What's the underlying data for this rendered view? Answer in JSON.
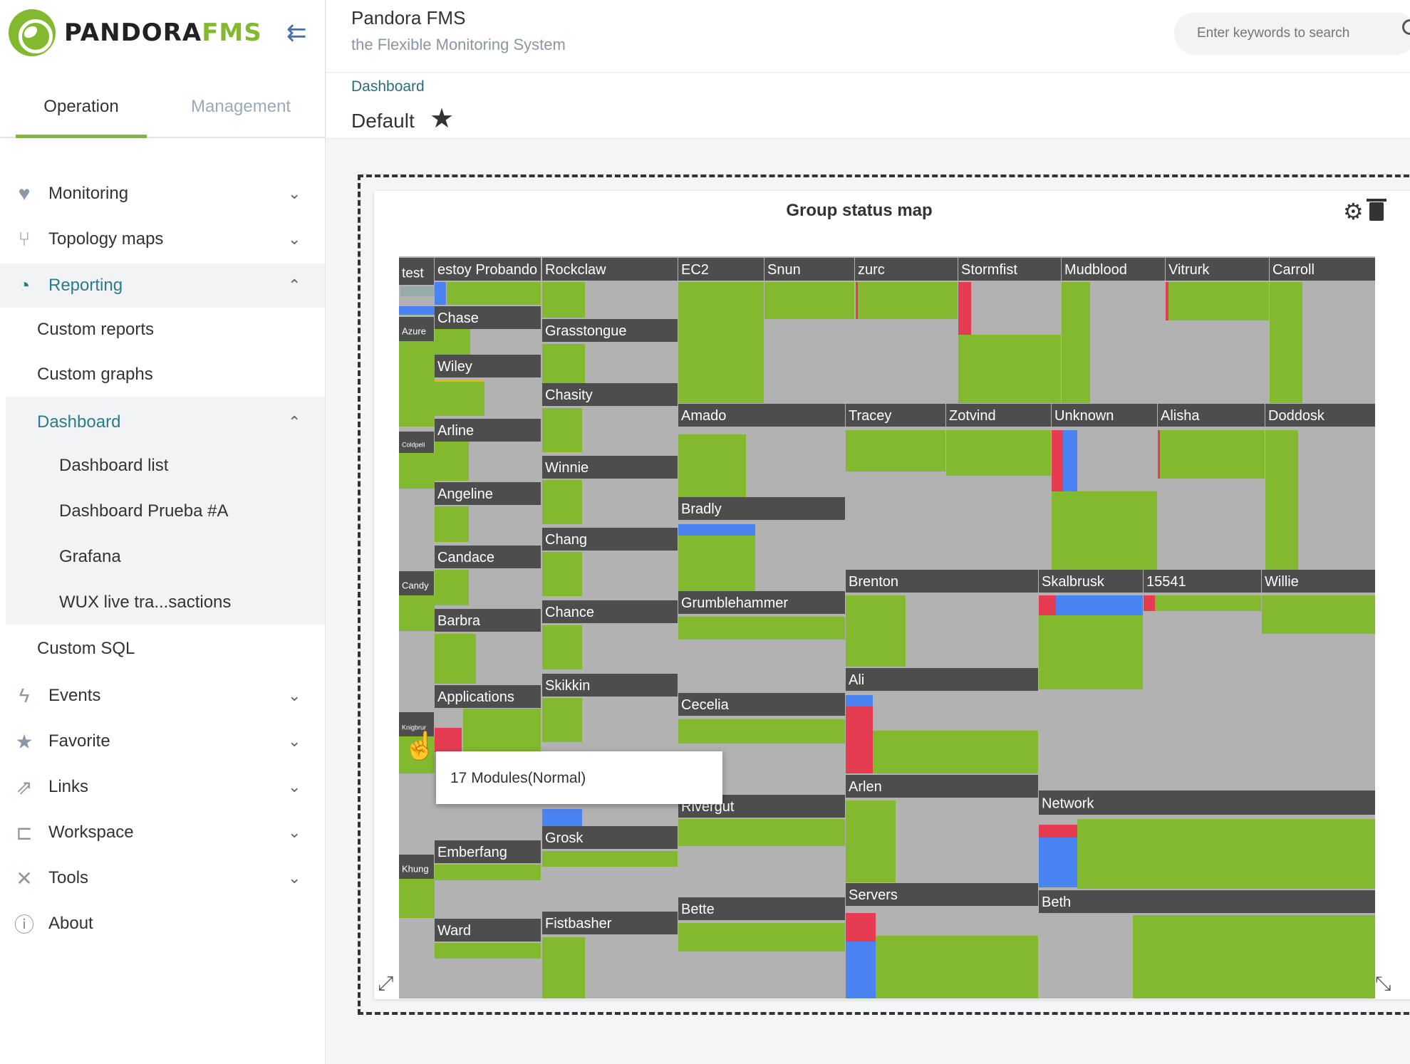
{
  "brand": {
    "name_a": "PANDORA",
    "name_b": "FMS",
    "logo": "pandora-logo",
    "color": "#82b92e"
  },
  "header": {
    "title": "Pandora FMS",
    "subtitle": "the Flexible Monitoring System",
    "search_placeholder": "Enter keywords to search"
  },
  "tabs": {
    "operation": "Operation",
    "management": "Management"
  },
  "menu": {
    "monitoring": "Monitoring",
    "topology": "Topology maps",
    "reporting": "Reporting",
    "custom_reports": "Custom reports",
    "custom_graphs": "Custom graphs",
    "dashboard": "Dashboard",
    "dashboard_list": "Dashboard list",
    "dashboard_prueba": "Dashboard Prueba #A",
    "grafana": "Grafana",
    "wux": "WUX live tra...sactions",
    "custom_sql": "Custom SQL",
    "events": "Events",
    "favorite": "Favorite",
    "links": "Links",
    "workspace": "Workspace",
    "tools": "Tools",
    "about": "About"
  },
  "breadcrumb": "Dashboard",
  "page_title": "Default",
  "widget": {
    "title": "Group status map",
    "tooltip": "17 Modules(Normal)"
  },
  "colors": {
    "normal": "#82b92e",
    "unknown": "#b2b2b2",
    "critical": "#e63c52",
    "notinit": "#4a83f2",
    "warning": "#f3b200",
    "label_bg": "#4d4d4d"
  },
  "groups": [
    "test",
    "estoy Probando",
    "Rockclaw",
    "EC2",
    "Snun",
    "zurc",
    "Stormfist",
    "Mudblood",
    "Vitrurk",
    "Carroll",
    "Azure",
    "Chase",
    "Grasstongue",
    "Wiley",
    "Chasity",
    "Arline",
    "Winnie",
    "Amado",
    "Tracey",
    "Zotvind",
    "Unknown",
    "Alisha",
    "Doddosk",
    "Coldpeli",
    "Angeline",
    "Bradly",
    "Chang",
    "Candace",
    "Candy",
    "Brenton",
    "Skalbrusk",
    "15541",
    "Willie",
    "Barbra",
    "Chance",
    "Grumblehammer",
    "Applications",
    "Skikkin",
    "Ali",
    "Cecelia",
    "Knigbrur",
    "Arlen",
    "Network",
    "Rivergut",
    "Emberfang",
    "Grosk",
    "Khung",
    "Servers",
    "Beth",
    "Bette",
    "Ward",
    "Fistbasher"
  ]
}
